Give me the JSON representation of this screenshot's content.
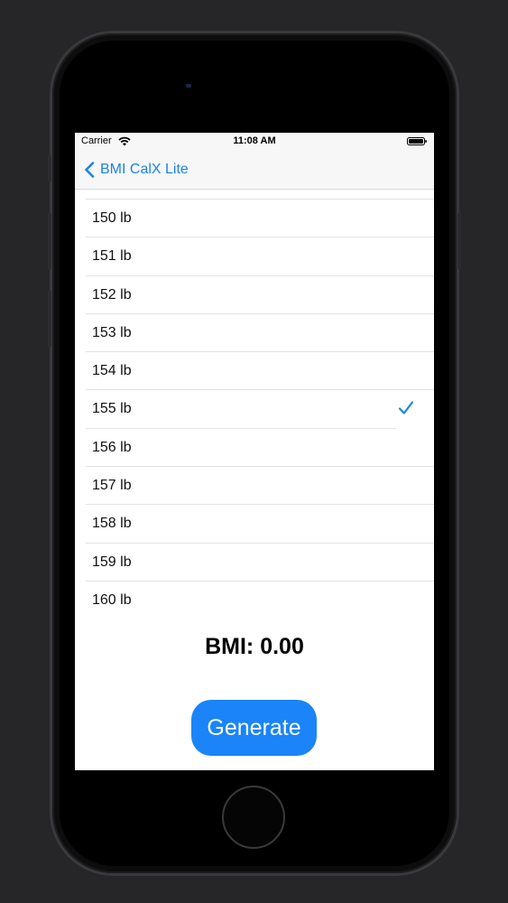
{
  "status_bar": {
    "carrier": "Carrier",
    "time": "11:08 AM"
  },
  "nav": {
    "back_label": "BMI CalX Lite"
  },
  "weight_list": {
    "items": [
      {
        "label": "150 lb",
        "selected": false
      },
      {
        "label": "151 lb",
        "selected": false
      },
      {
        "label": "152 lb",
        "selected": false
      },
      {
        "label": "153 lb",
        "selected": false
      },
      {
        "label": "154 lb",
        "selected": false
      },
      {
        "label": "155 lb",
        "selected": true
      },
      {
        "label": "156 lb",
        "selected": false
      },
      {
        "label": "157 lb",
        "selected": false
      },
      {
        "label": "158 lb",
        "selected": false
      },
      {
        "label": "159 lb",
        "selected": false
      },
      {
        "label": "160 lb",
        "selected": false
      }
    ]
  },
  "result": {
    "bmi_text": "BMI: 0.00"
  },
  "actions": {
    "generate_label": "Generate"
  },
  "colors": {
    "accent": "#1a84e6",
    "button": "#1a84f8",
    "background": "#262527"
  }
}
